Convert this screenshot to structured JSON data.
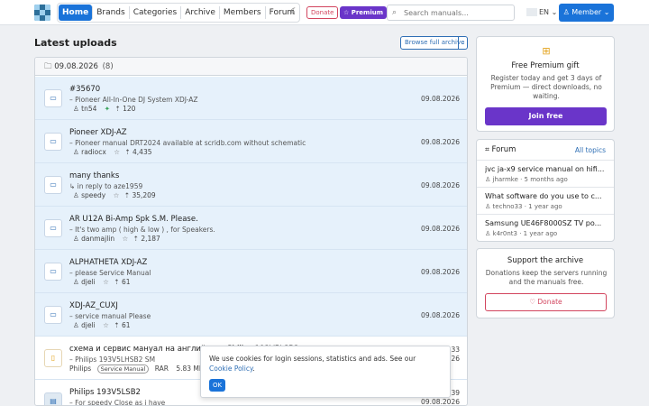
{
  "nav": {
    "items": [
      {
        "label": "Home",
        "active": true
      },
      {
        "label": "Brands"
      },
      {
        "label": "Categories"
      },
      {
        "label": "Archive"
      },
      {
        "label": "Members"
      },
      {
        "label": "Forum"
      }
    ],
    "donate_label": "Donate",
    "premium_label": "☆ Premium",
    "search_placeholder": "Search manuals...",
    "lang": "EN ⌄",
    "member_label": "♙ Member ⌄",
    "theme_icon": "moon-icon"
  },
  "main": {
    "title": "Latest uploads",
    "archive_button": "Browse full archive",
    "archive_dropdown": "⌄",
    "group": {
      "date": "09.08.2026",
      "count": "(8)"
    },
    "rows": [
      {
        "title": "#35670",
        "sub": "– Pioneer All-In-One DJ System XDJ-AZ",
        "user": "tn54",
        "extra": "",
        "count": "120",
        "date": "09.08.2026",
        "highlight": true
      },
      {
        "title": "Pioneer XDJ-AZ",
        "sub": "– Pioneer manual DRT2024 available at scridb.com without schematic",
        "user": "radiocx",
        "extra": "☆",
        "count": "4,435",
        "date": "09.08.2026",
        "highlight": true
      },
      {
        "title": "many thanks",
        "sub": "↳ in reply to aze1959",
        "user": "speedy",
        "extra": "☆",
        "count": "35,209",
        "date": "09.08.2026",
        "highlight": true
      },
      {
        "title": "AR U12A Bi-Amp Spk S.M. Please.",
        "sub": "– It's two amp ( high & low ) , for Speakers.",
        "user": "danmajlin",
        "extra": "☆",
        "count": "2,187",
        "date": "09.08.2026",
        "highlight": true
      },
      {
        "title": "ALPHATHETA XDJ-AZ",
        "sub": "– please Service Manual",
        "user": "djeli",
        "extra": "☆",
        "count": "61",
        "date": "09.08.2026",
        "highlight": true
      },
      {
        "title": "XDJ-AZ_CUXJ",
        "sub": "– service manual Please",
        "user": "djeli",
        "extra": "☆",
        "count": "61",
        "date": "09.08.2026",
        "highlight": true
      },
      {
        "title": "схема и сервис мануал на английском Philips 193V5LSB2",
        "sub": "– Philips 193V5LHSB2 SM",
        "brand": "Philips",
        "tag": "Service Manual",
        "format": "RAR",
        "size": "5.83 MB",
        "date_top": "33",
        "date": "26",
        "highlight": false
      },
      {
        "title": "Philips 193V5LSB2",
        "sub": "– For speedy Close as i have",
        "date_top": "39",
        "date": "09.08.2026",
        "highlight": false
      }
    ]
  },
  "sidebar": {
    "gift": {
      "title": "Free Premium gift",
      "desc": "Register today and get 3 days of Premium — direct downloads, no waiting.",
      "button": "Join free"
    },
    "forum": {
      "title": "Forum",
      "all_link": "All topics",
      "items": [
        {
          "title": "jvc ja-x9 service manual on hifi...",
          "meta": "jharmke · 5 months ago"
        },
        {
          "title": "What software do you use to c...",
          "meta": "techno33 · 1 year ago"
        },
        {
          "title": "Samsung UE46F8000SZ TV po...",
          "meta": "k4r0nt3 · 1 year ago"
        }
      ]
    },
    "support": {
      "title": "Support the archive",
      "desc": "Donations keep the servers running and the manuals free.",
      "button": "♡ Donate"
    }
  },
  "cookie": {
    "text": "We use cookies for login sessions, statistics and ads. See our ",
    "link": "Cookie Policy",
    "after": ".",
    "ok": "OK"
  },
  "colors": {
    "accent": "#1a73d9",
    "premium": "#6a35c9",
    "donate": "#d2455e",
    "highlight_row": "#e6f1fb"
  }
}
